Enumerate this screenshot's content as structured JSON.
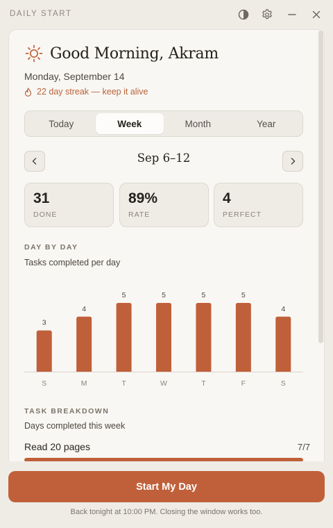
{
  "window": {
    "title": "DAILY START",
    "controls": [
      "contrast-icon",
      "gear-icon",
      "minimize-icon",
      "close-icon"
    ]
  },
  "colors": {
    "accent": "#c0603a",
    "background": "#efece6",
    "card": "#f9f7f3",
    "text": "#25211c"
  },
  "header": {
    "icon": "sun-icon",
    "greeting": "Good Morning, Akram",
    "date": "Monday, September 14",
    "streak_icon": "flame-icon",
    "streak": "22 day streak — keep it alive"
  },
  "tabs": [
    {
      "label": "Today",
      "active": false
    },
    {
      "label": "Week",
      "active": true
    },
    {
      "label": "Month",
      "active": false
    },
    {
      "label": "Year",
      "active": false
    }
  ],
  "period": {
    "range": "Sep 6–12",
    "prev_icon": "chevron-left-icon",
    "next_icon": "chevron-right-icon"
  },
  "stats": [
    {
      "value": "31",
      "label": "DONE"
    },
    {
      "value": "89%",
      "label": "RATE"
    },
    {
      "value": "4",
      "label": "PERFECT"
    }
  ],
  "day_by_day": {
    "title": "DAY BY DAY",
    "subtitle": "Tasks completed per day"
  },
  "chart_data": {
    "type": "bar",
    "title": "",
    "categories": [
      "S",
      "M",
      "T",
      "W",
      "T",
      "F",
      "S"
    ],
    "values": [
      3,
      4,
      5,
      5,
      5,
      5,
      4
    ],
    "ylim": [
      0,
      5
    ],
    "grid": false,
    "color": "#c0603a"
  },
  "breakdown": {
    "title": "TASK BREAKDOWN",
    "subtitle": "Days completed this week",
    "tasks": [
      {
        "name": "Read 20 pages",
        "count": "7/7",
        "progress": 1.0
      }
    ]
  },
  "actions": {
    "primary": "Start My Day",
    "footnote": "Back tonight at 10:00 PM. Closing the window works too."
  }
}
